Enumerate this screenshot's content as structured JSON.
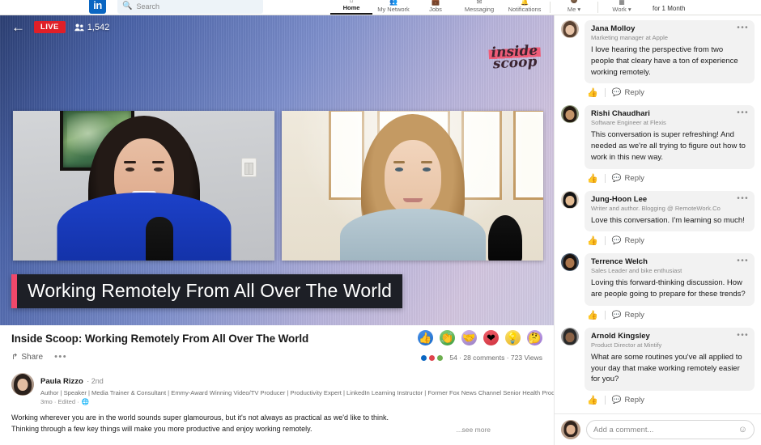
{
  "nav": {
    "logo": "in",
    "search_placeholder": "Search",
    "search_icon": "search-icon",
    "items": [
      {
        "label": "Home",
        "icon": "home-icon",
        "active": true
      },
      {
        "label": "My Network",
        "icon": "network-icon",
        "active": false
      },
      {
        "label": "Jobs",
        "icon": "jobs-icon",
        "active": false
      },
      {
        "label": "Messaging",
        "icon": "messaging-icon",
        "active": false
      },
      {
        "label": "Notifications",
        "icon": "bell-icon",
        "active": false
      },
      {
        "label": "Me ▾",
        "icon": "avatar-icon",
        "active": false
      },
      {
        "label": "Work ▾",
        "icon": "grid-icon",
        "active": false
      }
    ],
    "promo": "for 1 Month"
  },
  "video": {
    "back_icon": "back-arrow-icon",
    "live_badge": "LIVE",
    "viewer_count": "1,542",
    "viewers_icon": "people-icon",
    "brand_line1": "inside",
    "brand_line2": "scoop",
    "caption": "Working Remotely From All Over The World",
    "accent_color": "#f0486a"
  },
  "post": {
    "title": "Inside Scoop: Working Remotely From All Over The World",
    "share_label": "Share",
    "share_icon": "share-icon",
    "more_icon": "ellipsis-icon",
    "reactions": [
      {
        "name": "like-reaction",
        "glyph": "👍"
      },
      {
        "name": "celebrate-reaction",
        "glyph": "👏"
      },
      {
        "name": "support-reaction",
        "glyph": "🤝"
      },
      {
        "name": "love-reaction",
        "glyph": "❤"
      },
      {
        "name": "insightful-reaction",
        "glyph": "💡"
      },
      {
        "name": "curious-reaction",
        "glyph": "🤔"
      }
    ],
    "stats": "54 · 28 comments · 723 Views",
    "author": {
      "name": "Paula Rizzo",
      "degree": "· 2nd",
      "headline": "Author | Speaker | Media Trainer & Consultant | Emmy-Award Winning Video/TV Producer | Productivity Expert | LinkedIn Learning Instructor | Former Fox News Channel Senior Health Producer",
      "time": "3mo · Edited ·",
      "visibility_icon": "globe-icon"
    },
    "body_line1": "Working wherever you are in the world sounds super glamourous, but it's not always as practical as we'd like to think.",
    "body_line2": "Thinking through a few key things will make you more productive and enjoy working remotely.",
    "see_more": "...see more"
  },
  "comments": {
    "items": [
      {
        "name": "Jana Molloy",
        "headline": "Marketing manager at Apple",
        "text": "I love hearing the perspective from two people that cleary have a ton of experience working remotely.",
        "like_icon": "thumbs-up-icon",
        "reply_label": "Reply",
        "reply_icon": "comment-icon",
        "more_icon": "ellipsis-icon",
        "avatar_bg": "#cbb7a8",
        "avatar_hair": "#5a4232",
        "avatar_face": "#e8c4a8"
      },
      {
        "name": "Rishi Chaudhari",
        "headline": "Software Engineer at Flexis",
        "text": "This conversation is super refreshing! And needed as we're all trying to figure out how to work in this new way.",
        "like_icon": "thumbs-up-icon",
        "reply_label": "Reply",
        "reply_icon": "comment-icon",
        "more_icon": "ellipsis-icon",
        "avatar_bg": "#8f9a7c",
        "avatar_hair": "#241a12",
        "avatar_face": "#c39468"
      },
      {
        "name": "Jung-Hoon Lee",
        "headline": "Writer and author. Blogging @ RemoteWork.Co",
        "text": "Love this conversation. I'm learning so much!",
        "like_icon": "thumbs-up-icon",
        "reply_label": "Reply",
        "reply_icon": "comment-icon",
        "more_icon": "ellipsis-icon",
        "avatar_bg": "#d9cfc2",
        "avatar_hair": "#141414",
        "avatar_face": "#e3bb92"
      },
      {
        "name": "Terrence Welch",
        "headline": "Sales Leader and bike enthusiast",
        "text": "Loving this forward-thinking discussion. How are people going to prepare for these trends?",
        "like_icon": "thumbs-up-icon",
        "reply_label": "Reply",
        "reply_icon": "comment-icon",
        "more_icon": "ellipsis-icon",
        "avatar_bg": "#4a5c6e",
        "avatar_hair": "#1b1410",
        "avatar_face": "#a9754c"
      },
      {
        "name": "Arnold Kingsley",
        "headline": "Product Director at Mintify",
        "text": "What are some routines you've all applied to your day that make working remotely easier for you?",
        "like_icon": "thumbs-up-icon",
        "reply_label": "Reply",
        "reply_icon": "comment-icon",
        "more_icon": "ellipsis-icon",
        "avatar_bg": "#9a9a9a",
        "avatar_hair": "#2a2a2a",
        "avatar_face": "#8a6246"
      }
    ],
    "composer_placeholder": "Add a comment...",
    "composer_emoji_icon": "emoji-icon",
    "composer_avatar_bg": "#b99f8c"
  }
}
